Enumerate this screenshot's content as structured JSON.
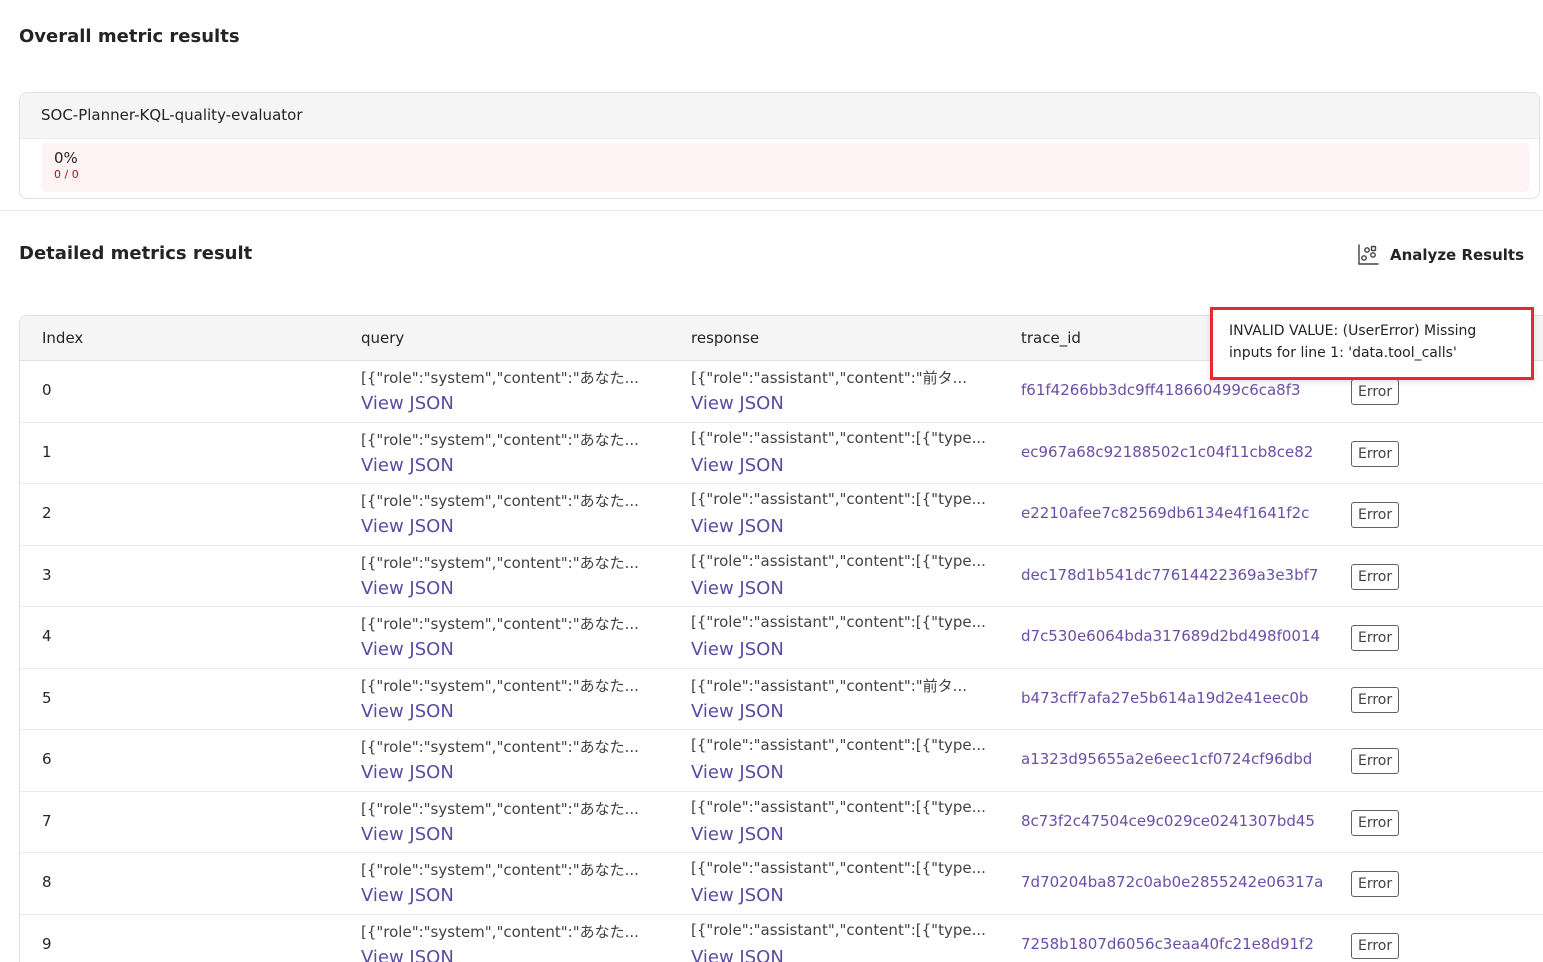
{
  "overall": {
    "title": "Overall metric results",
    "evaluator_name": "SOC-Planner-KQL-quality-evaluator",
    "percent": "0%",
    "count": "0 / 0"
  },
  "detailed": {
    "title": "Detailed metrics result",
    "analyze_label": "Analyze Results"
  },
  "table": {
    "headers": {
      "index": "Index",
      "query": "query",
      "response": "response",
      "trace_id": "trace_id"
    },
    "rows": [
      {
        "index": "0",
        "query": "[{\"role\":\"system\",\"content\":\"あなた...",
        "query_link": "View JSON",
        "response": "[{\"role\":\"assistant\",\"content\":\"前タ...",
        "response_link": "View JSON",
        "trace_id": "f61f4266bb3dc9ff418660499c6ca8f3",
        "status": "Error"
      },
      {
        "index": "1",
        "query": "[{\"role\":\"system\",\"content\":\"あなた...",
        "query_link": "View JSON",
        "response": "[{\"role\":\"assistant\",\"content\":[{\"type...",
        "response_link": "View JSON",
        "trace_id": "ec967a68c92188502c1c04f11cb8ce82",
        "status": "Error"
      },
      {
        "index": "2",
        "query": "[{\"role\":\"system\",\"content\":\"あなた...",
        "query_link": "View JSON",
        "response": "[{\"role\":\"assistant\",\"content\":[{\"type...",
        "response_link": "View JSON",
        "trace_id": "e2210afee7c82569db6134e4f1641f2c",
        "status": "Error"
      },
      {
        "index": "3",
        "query": "[{\"role\":\"system\",\"content\":\"あなた...",
        "query_link": "View JSON",
        "response": "[{\"role\":\"assistant\",\"content\":[{\"type...",
        "response_link": "View JSON",
        "trace_id": "dec178d1b541dc77614422369a3e3bf7",
        "status": "Error"
      },
      {
        "index": "4",
        "query": "[{\"role\":\"system\",\"content\":\"あなた...",
        "query_link": "View JSON",
        "response": "[{\"role\":\"assistant\",\"content\":[{\"type...",
        "response_link": "View JSON",
        "trace_id": "d7c530e6064bda317689d2bd498f0014",
        "status": "Error"
      },
      {
        "index": "5",
        "query": "[{\"role\":\"system\",\"content\":\"あなた...",
        "query_link": "View JSON",
        "response": "[{\"role\":\"assistant\",\"content\":\"前タ...",
        "response_link": "View JSON",
        "trace_id": "b473cff7afa27e5b614a19d2e41eec0b",
        "status": "Error"
      },
      {
        "index": "6",
        "query": "[{\"role\":\"system\",\"content\":\"あなた...",
        "query_link": "View JSON",
        "response": "[{\"role\":\"assistant\",\"content\":[{\"type...",
        "response_link": "View JSON",
        "trace_id": "a1323d95655a2e6eec1cf0724cf96dbd",
        "status": "Error"
      },
      {
        "index": "7",
        "query": "[{\"role\":\"system\",\"content\":\"あなた...",
        "query_link": "View JSON",
        "response": "[{\"role\":\"assistant\",\"content\":[{\"type...",
        "response_link": "View JSON",
        "trace_id": "8c73f2c47504ce9c029ce0241307bd45",
        "status": "Error"
      },
      {
        "index": "8",
        "query": "[{\"role\":\"system\",\"content\":\"あなた...",
        "query_link": "View JSON",
        "response": "[{\"role\":\"assistant\",\"content\":[{\"type...",
        "response_link": "View JSON",
        "trace_id": "7d70204ba872c0ab0e2855242e06317a",
        "status": "Error"
      },
      {
        "index": "9",
        "query": "[{\"role\":\"system\",\"content\":\"あなた...",
        "query_link": "View JSON",
        "response": "[{\"role\":\"assistant\",\"content\":[{\"type...",
        "response_link": "View JSON",
        "trace_id": "7258b1807d6056c3eaa40fc21e8d91f2",
        "status": "Error"
      }
    ]
  },
  "tooltip": {
    "text": "INVALID VALUE: (UserError) Missing inputs for line 1: 'data.tool_calls'"
  },
  "colors": {
    "link": "#5b4aa3",
    "trace_link": "#6b4ea8",
    "tooltip_border": "#e8282e",
    "error_count": "#b10e1c",
    "metric_fill": "#fdf3f4"
  },
  "icons": {
    "analyze": "analyze-results-icon"
  }
}
